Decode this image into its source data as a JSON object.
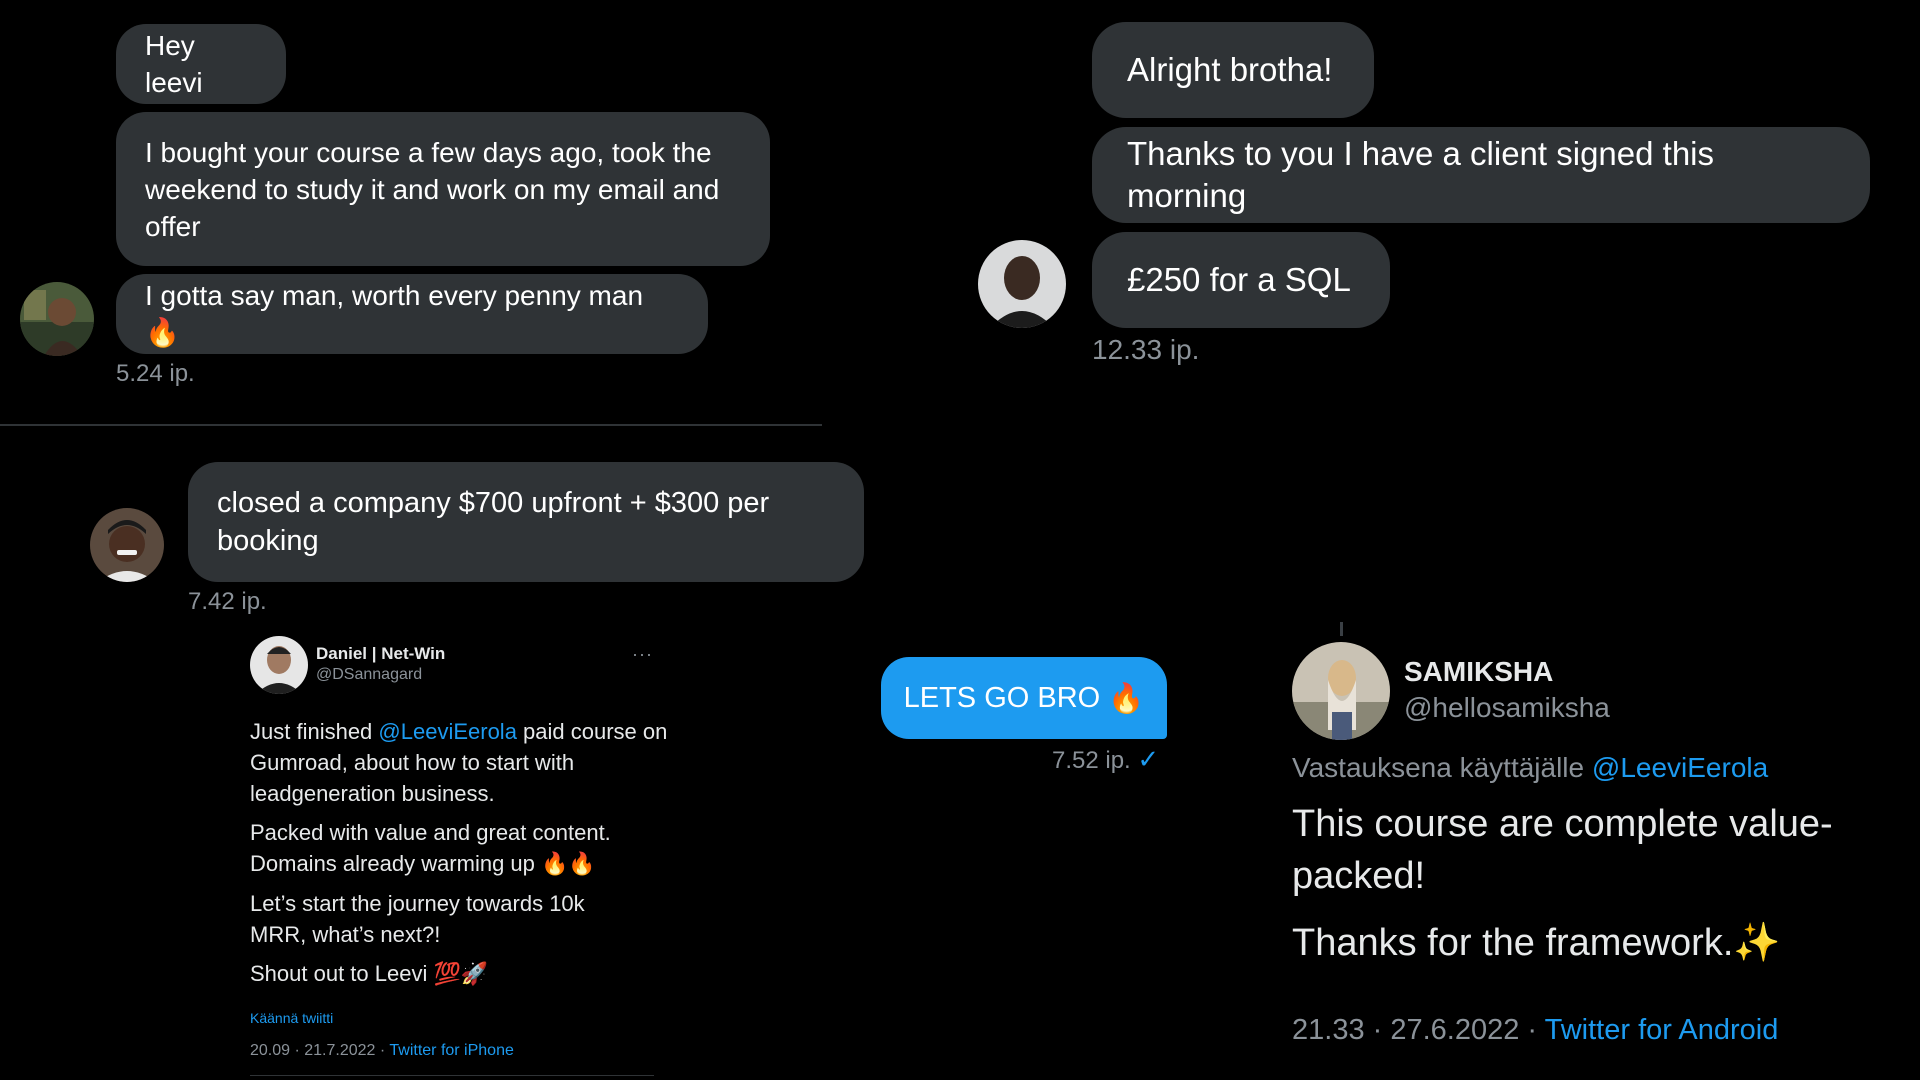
{
  "dm1": {
    "messages": [
      "Hey leevi",
      "I bought your course a few days ago, took the weekend to study it and work on my email and offer",
      "I gotta say man, worth every penny man"
    ],
    "emoji": "🔥",
    "time": "5.24 ip."
  },
  "dm2": {
    "messages": [
      "Alright brotha!",
      "Thanks to you I have a client signed this morning",
      "£250 for a SQL"
    ],
    "time": "12.33 ip."
  },
  "dm3": {
    "message": "closed a company $700 upfront + $300 per booking",
    "time": "7.42 ip."
  },
  "tweet1": {
    "name": "Daniel | Net-Win",
    "handle": "@DSannagard",
    "more": "···",
    "p1_before": "Just finished ",
    "p1_mention": "@LeeviEerola",
    "p1_after": " paid course on Gumroad, about how to start with leadgeneration business.",
    "p2_line1": "Packed with value and great content.",
    "p2_line2": "Domains already warming up",
    "p2_emoji": "🔥🔥",
    "p3": "Let’s start the journey towards 10k MRR, what’s next?!",
    "p4": "Shout out to Leevi",
    "p4_emoji": "💯🚀",
    "translate": "Käännä twiitti",
    "meta_time": "20.09 · 21.7.2022 · ",
    "meta_source": "Twitter for iPhone"
  },
  "sent": {
    "message": "LETS GO BRO",
    "emoji": "🔥",
    "time": "7.52 ip.",
    "check": "✓"
  },
  "tweet2": {
    "name": "SAMIKSHA",
    "handle": "@hellosamiksha",
    "reply_prefix": "Vastauksena käyttäjälle ",
    "reply_mention": "@LeeviEerola",
    "p1": "This course are complete value-packed!",
    "p2": "Thanks for the framework.",
    "p2_emoji": "✨",
    "meta_time": "21.33 · 27.6.2022 · ",
    "meta_source": "Twitter for Android"
  },
  "colors": {
    "bubble": "#2f3336",
    "accent": "#1d9bf0",
    "muted": "#8b9299"
  }
}
